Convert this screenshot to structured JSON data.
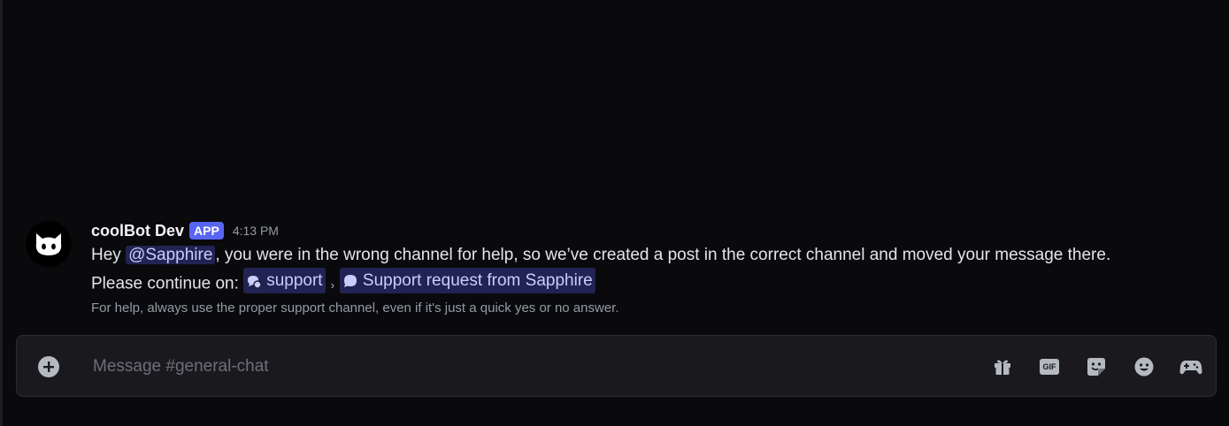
{
  "message": {
    "username": "coolBot Dev",
    "tag": "APP",
    "timestamp": "4:13 PM",
    "line1_start": "Hey ",
    "mention": "@Sapphire",
    "line1_end": ", you were in the wrong channel for help, so we’ve created a post in the correct channel and moved your message there.",
    "line2_start": "Please continue on: ",
    "channel": "support",
    "separator": "›",
    "thread": "Support request from Sapphire",
    "subtext": "For help, always use the proper support channel, even if it's just a quick yes or no answer."
  },
  "composer": {
    "placeholder": "Message #general-chat",
    "gif_label": "GIF",
    "tools": [
      "gift-icon",
      "gif-icon",
      "sticker-icon",
      "emoji-icon",
      "activity-icon"
    ]
  },
  "colors": {
    "background": "#0a0a0d",
    "accent": "#5865f2",
    "mention_text": "#c9cdfb"
  }
}
